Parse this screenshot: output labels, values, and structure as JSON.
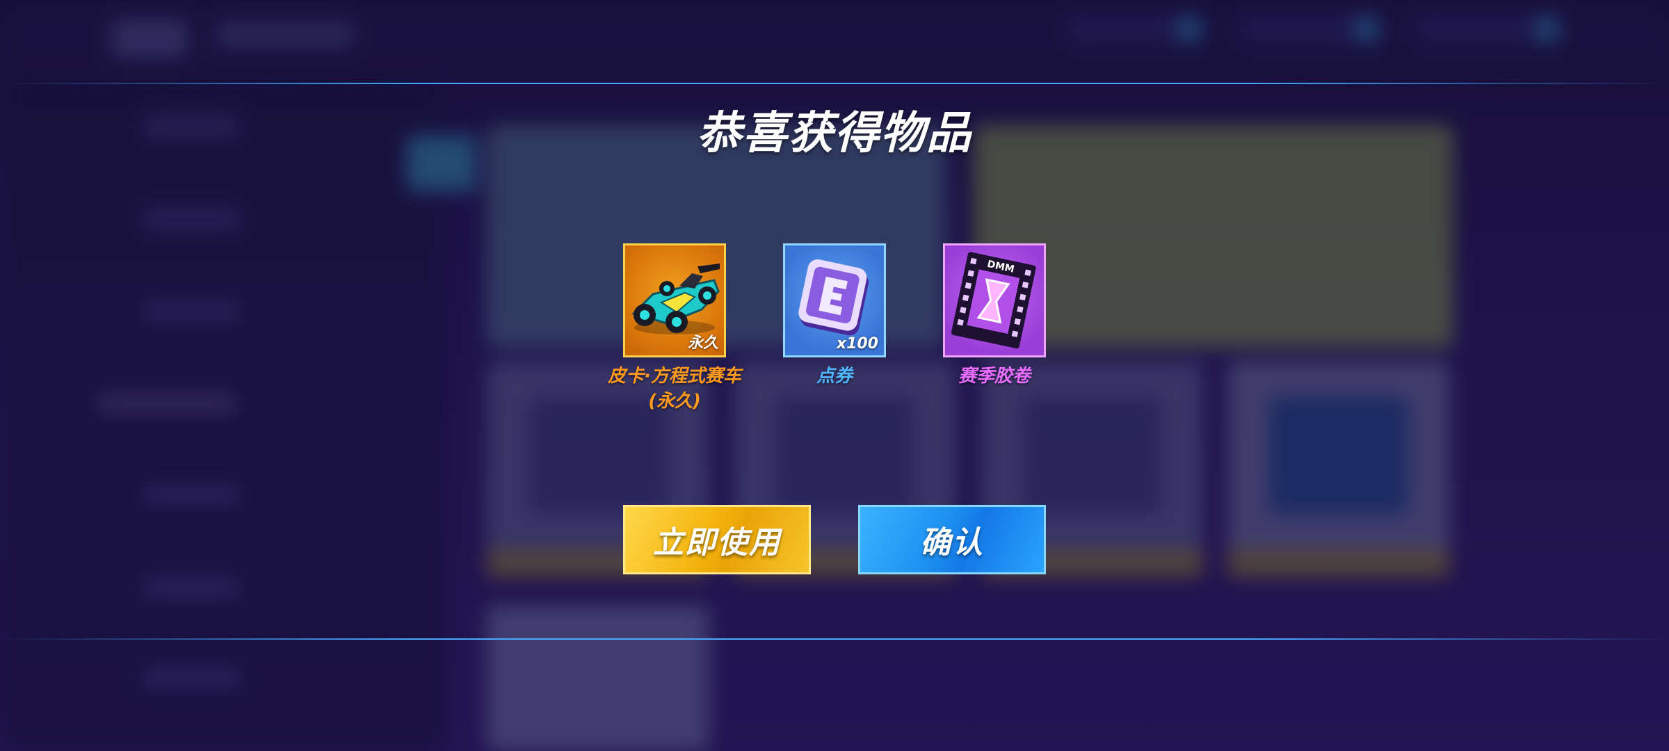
{
  "dialog": {
    "title": "恭喜获得物品",
    "items": [
      {
        "name": "皮卡·方程式赛车\n(永久)",
        "badge": "永久",
        "icon": "race-car-icon",
        "rarity_color": "#ff9a1e"
      },
      {
        "name": "点券",
        "badge": "x100",
        "icon": "e-coupon-icon",
        "rarity_color": "#4fb6ff"
      },
      {
        "name": "赛季胶卷",
        "badge": "",
        "icon": "film-roll-icon",
        "film_text": "DMM",
        "rarity_color": "#e86cff"
      }
    ],
    "buttons": {
      "use_now": "立即使用",
      "confirm": "确认"
    }
  },
  "colors": {
    "accent_line": "#4aa9ff",
    "use_button": "#f4b40e",
    "confirm_button": "#1c8ff0"
  }
}
